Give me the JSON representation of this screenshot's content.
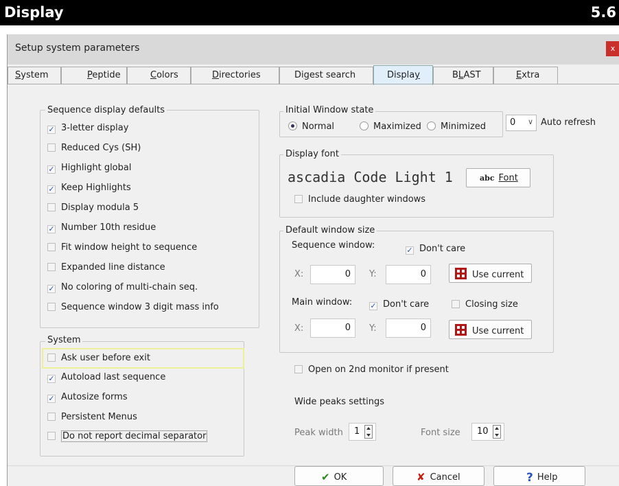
{
  "doc_header": {
    "title": "Display",
    "section": "5.6"
  },
  "dialog": {
    "title": "Setup system parameters",
    "close_label": "x"
  },
  "tabs": [
    {
      "label": "System",
      "underline": "S",
      "rest": "ystem"
    },
    {
      "label": "Peptide",
      "underline": "P",
      "rest": "eptide"
    },
    {
      "label": "Colors",
      "underline": "C",
      "rest": "olors"
    },
    {
      "label": "Directories",
      "underline": "D",
      "rest": "irectories"
    },
    {
      "label": "Digest search",
      "pre": "Di",
      "underline": "g",
      "rest": "est search"
    },
    {
      "label": "Display",
      "pre": "Displa",
      "underline": "y",
      "rest": ""
    },
    {
      "label": "BLAST",
      "pre": "B",
      "underline": "L",
      "rest": "AST"
    },
    {
      "label": "Extra",
      "underline": "E",
      "rest": "xtra"
    }
  ],
  "seq_defaults": {
    "legend": "Sequence display defaults",
    "items": [
      {
        "label": "3-letter display",
        "checked": true
      },
      {
        "label": "Reduced Cys (SH)",
        "checked": false
      },
      {
        "label": "Highlight global",
        "checked": true
      },
      {
        "label": "Keep Highlights",
        "checked": true
      },
      {
        "label": "Display modula 5",
        "checked": false
      },
      {
        "label": "Number 10th residue",
        "checked": true
      },
      {
        "label": "Fit window height to sequence",
        "checked": false
      },
      {
        "label": "Expanded line distance",
        "checked": false
      },
      {
        "label": "No coloring of multi-chain seq.",
        "checked": true
      },
      {
        "label": "Sequence window 3 digit mass info",
        "checked": false
      }
    ]
  },
  "system_group": {
    "legend": "System",
    "items": [
      {
        "label": "Ask user before exit",
        "checked": false
      },
      {
        "label": "Autoload last sequence",
        "checked": true
      },
      {
        "label": "Autosize forms",
        "checked": true
      },
      {
        "label": "Persistent Menus",
        "checked": false
      },
      {
        "label": "Do not report decimal separator",
        "checked": false
      }
    ]
  },
  "window_state": {
    "legend": "Initial Window state",
    "options": [
      {
        "label": "Normal",
        "selected": true
      },
      {
        "label": "Maximized",
        "selected": false
      },
      {
        "label": "Minimized",
        "selected": false
      }
    ],
    "auto_refresh_value": "0",
    "auto_refresh_label": "Auto refresh"
  },
  "display_font": {
    "legend": "Display font",
    "sample": "ascadia Code Light 1",
    "font_button": "Font",
    "font_button_icon": "abc",
    "include_daughter": "Include daughter windows",
    "include_daughter_checked": false
  },
  "window_size": {
    "legend": "Default window size",
    "sequence_label": "Sequence window:",
    "sequence_dont_care": "Don't care",
    "sequence_dont_care_checked": true,
    "x_label": "X:",
    "y_label": "Y:",
    "seq_x": "0",
    "seq_y": "0",
    "use_current": "Use current",
    "main_label": "Main window:",
    "main_dont_care": "Don't care",
    "main_dont_care_checked": true,
    "closing_size": "Closing size",
    "closing_size_checked": false,
    "main_x": "0",
    "main_y": "0"
  },
  "second_monitor": {
    "label": "Open on 2nd monitor if present",
    "checked": false
  },
  "wide_peaks": {
    "title": "Wide peaks settings",
    "peak_width_label": "Peak width",
    "peak_width_value": "1",
    "font_size_label": "Font size",
    "font_size_value": "10"
  },
  "footer": {
    "ok": "OK",
    "cancel": "Cancel",
    "help": "Help"
  }
}
